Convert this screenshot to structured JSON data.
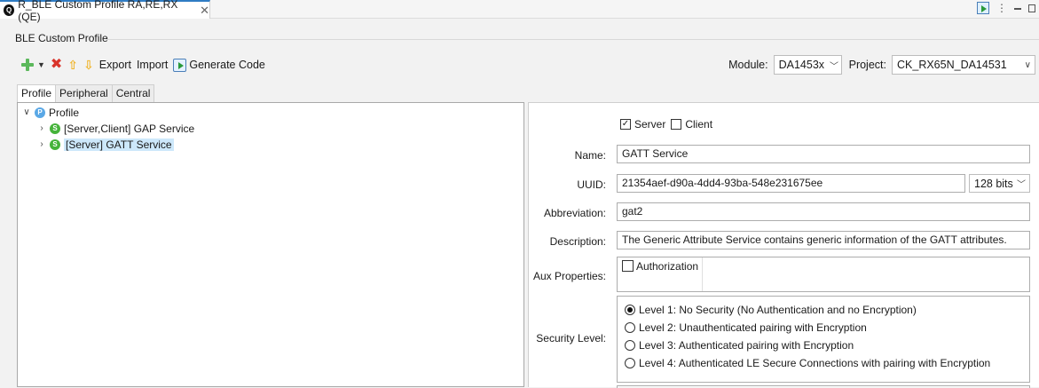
{
  "editor_tab": {
    "title": "R_BLE Custom Profile RA,RE,RX (QE)",
    "close": "✕"
  },
  "section": {
    "title": "BLE Custom Profile"
  },
  "toolbar": {
    "export": "Export",
    "import": "Import",
    "generate_code": "Generate Code"
  },
  "module": {
    "label": "Module:",
    "value": "DA1453x"
  },
  "project": {
    "label": "Project:",
    "value": "CK_RX65N_DA14531"
  },
  "profile_tabs": [
    "Profile",
    "Peripheral",
    "Central"
  ],
  "tree": {
    "root": {
      "badge": "P",
      "label": "Profile"
    },
    "items": [
      {
        "badge": "S",
        "label": "[Server,Client] GAP Service"
      },
      {
        "badge": "S",
        "label": "[Server] GATT Service"
      }
    ]
  },
  "detail": {
    "role_server": "Server",
    "role_client": "Client",
    "name_label": "Name:",
    "name_value": "GATT Service",
    "uuid_label": "UUID:",
    "uuid_value": "21354aef-d90a-4dd4-93ba-548e231675ee",
    "uuid_bits": "128 bits",
    "abbr_label": "Abbreviation:",
    "abbr_value": "gat2",
    "desc_label": "Description:",
    "desc_value": "The Generic Attribute Service contains generic information of the GATT attributes.",
    "aux_label": "Aux Properties:",
    "aux_authorization": "Authorization",
    "security_label": "Security Level:",
    "security_levels": [
      "Level 1: No Security (No Authentication and no Encryption)",
      "Level 2: Unauthenticated pairing with Encryption",
      "Level 3: Authenticated pairing with Encryption",
      "Level 4: Authenticated LE Secure Connections with pairing with Encryption"
    ]
  },
  "colors": {
    "selection": "#cde8fb",
    "accent": "#2f7cc4"
  }
}
